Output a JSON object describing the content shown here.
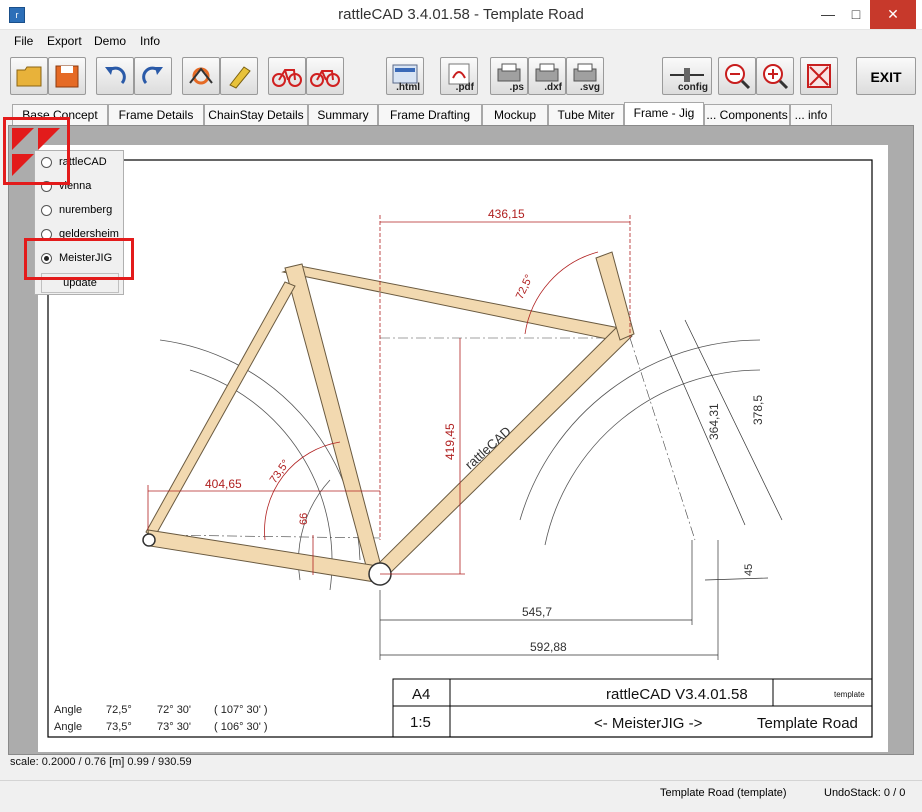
{
  "window": {
    "title": "rattleCAD  3.4.01.58 - Template Road",
    "minimize": "—",
    "maximize": "□",
    "close": "✕"
  },
  "menu": [
    "File",
    "Export",
    "Demo",
    "Info"
  ],
  "toolbar": {
    "buttons": [
      {
        "icon": "open-folder-icon"
      },
      {
        "icon": "save-icon"
      },
      {
        "icon": "undo-icon"
      },
      {
        "icon": "redo-icon"
      },
      {
        "icon": "frame-settings-icon"
      },
      {
        "icon": "edit-icon"
      },
      {
        "icon": "bike-red-icon"
      },
      {
        "icon": "bike-red-2-icon"
      },
      {
        "icon": "export-html-icon",
        "label": ".html"
      },
      {
        "icon": "export-pdf-icon",
        "label": ".pdf"
      },
      {
        "icon": "export-ps-icon",
        "label": ".ps"
      },
      {
        "icon": "export-dxf-icon",
        "label": ".dxf"
      },
      {
        "icon": "export-svg-icon",
        "label": ".svg"
      },
      {
        "icon": "config-icon",
        "label": "config"
      },
      {
        "icon": "zoom-out-icon"
      },
      {
        "icon": "zoom-in-icon"
      },
      {
        "icon": "fit-view-icon"
      }
    ],
    "exit_label": "EXIT"
  },
  "tabs": [
    "Base Concept",
    "Frame Details",
    "ChainStay Details",
    "Summary",
    "Frame Drafting",
    "Mockup",
    "Tube Miter",
    "Frame - Jig",
    "... Components",
    "... info"
  ],
  "active_tab": "Frame - Jig",
  "variant_panel": {
    "options": [
      "rattleCAD",
      "vienna",
      "nuremberg",
      "geldersheim",
      "MeisterJIG"
    ],
    "selected": "MeisterJIG",
    "update_label": "update"
  },
  "drawing": {
    "dims": {
      "top_len": "436,15",
      "head_angle": "72,5°",
      "height": "419,45",
      "left_len": "404,65",
      "seat_angle": "73,5°",
      "bb_drop": "66",
      "fork_len_a": "364,31",
      "fork_len_b": "378,5",
      "bottom_a": "545,7",
      "bottom_b": "592,88",
      "rake": "45"
    },
    "tube_brand": "rattleCAD",
    "angle_table": [
      {
        "label": "Angle",
        "deg": "72,5°",
        "dms": "72° 30'",
        "comp": "( 107° 30' )"
      },
      {
        "label": "Angle",
        "deg": "73,5°",
        "dms": "73° 30'",
        "comp": "( 106° 30' )"
      }
    ],
    "title_block": {
      "format": "A4",
      "scale": "1:5",
      "app": "rattleCAD   V3.4.01.58",
      "tag": "template",
      "jig": "<- MeisterJIG ->",
      "project": "Template Road"
    }
  },
  "scale_info": "scale: 0.2000 / 0.76  [m]  0.99 / 930.59",
  "status": {
    "project": "Template Road (template)",
    "undo": "UndoStack:  0 / 0"
  },
  "colors": {
    "dimension": "#b02020",
    "tube_fill": "#f2d9b0",
    "tube_stroke": "#6a5a40",
    "highlight": "#e31b1b"
  }
}
